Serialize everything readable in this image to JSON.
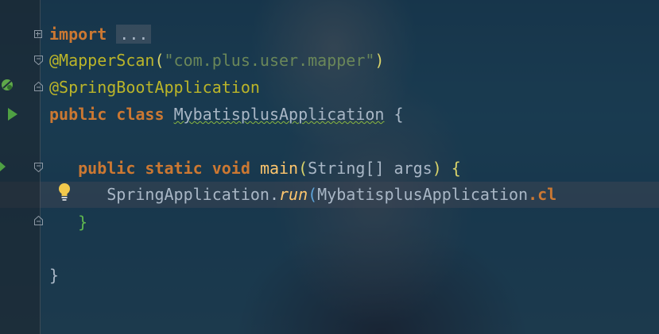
{
  "editor": {
    "lines": {
      "l1": {
        "kw": "import",
        "folded": "..."
      },
      "l2": {
        "ann": "@MapperScan",
        "open": "(",
        "str": "\"com.plus.user.mapper\"",
        "close": ")"
      },
      "l3": {
        "ann": "@SpringBootApplication"
      },
      "l4": {
        "kw1": "public",
        "kw2": "class",
        "name": "MybatisplusApplication",
        "brace": "{"
      },
      "l6": {
        "kw1": "public",
        "kw2": "static",
        "kw3": "void",
        "fn": "main",
        "open": "(",
        "type": "String[]",
        "arg": "args",
        "close": ")",
        "brace": "{"
      },
      "l7": {
        "cls": "SpringApplication",
        "dot": ".",
        "method": "run",
        "open": "(",
        "arg": "MybatisplusApplication",
        "rest": ".cl"
      },
      "l8": {
        "brace": "}"
      },
      "l10": {
        "brace": "}"
      }
    }
  },
  "colors": {
    "keyword": "#cc7832",
    "annotation": "#bbb529",
    "string": "#6a8759",
    "method": "#ffc66d",
    "text": "#a9b7c6"
  },
  "icons": {
    "run_class": "run-arrow-icon",
    "spring_bean": "spring-bean-icon",
    "intention": "lightbulb-icon"
  }
}
